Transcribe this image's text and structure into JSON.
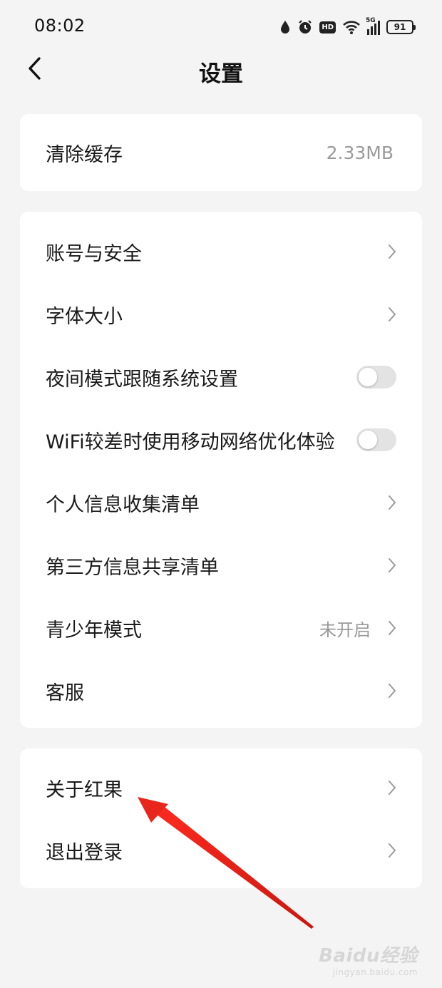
{
  "status_bar": {
    "time": "08:02",
    "network": "5G",
    "hd": "HD",
    "battery": "91"
  },
  "header": {
    "title": "设置"
  },
  "cache_card": {
    "label": "清除缓存",
    "value": "2.33MB"
  },
  "settings": {
    "account_security": "账号与安全",
    "font_size": "字体大小",
    "night_mode_follow_system": "夜间模式跟随系统设置",
    "wifi_mobile_optimize": "WiFi较差时使用移动网络优化体验",
    "personal_info_list": "个人信息收集清单",
    "third_party_sharing_list": "第三方信息共享清单",
    "youth_mode": "青少年模式",
    "youth_mode_status": "未开启",
    "customer_service": "客服"
  },
  "toggles": {
    "night_mode_on": false,
    "wifi_optimize_on": false
  },
  "bottom_card": {
    "about": "关于红果",
    "logout": "退出登录"
  },
  "annotation": {
    "arrow_color": "#e8261c"
  },
  "watermark": {
    "main": "Baidu经验",
    "sub": "jingyan.baidu.com"
  },
  "colors": {
    "background": "#f4f4f4",
    "card": "#ffffff",
    "text": "#1a1a1a",
    "secondary_text": "#9a9a9a",
    "toggle_off": "#e3e3e3"
  }
}
